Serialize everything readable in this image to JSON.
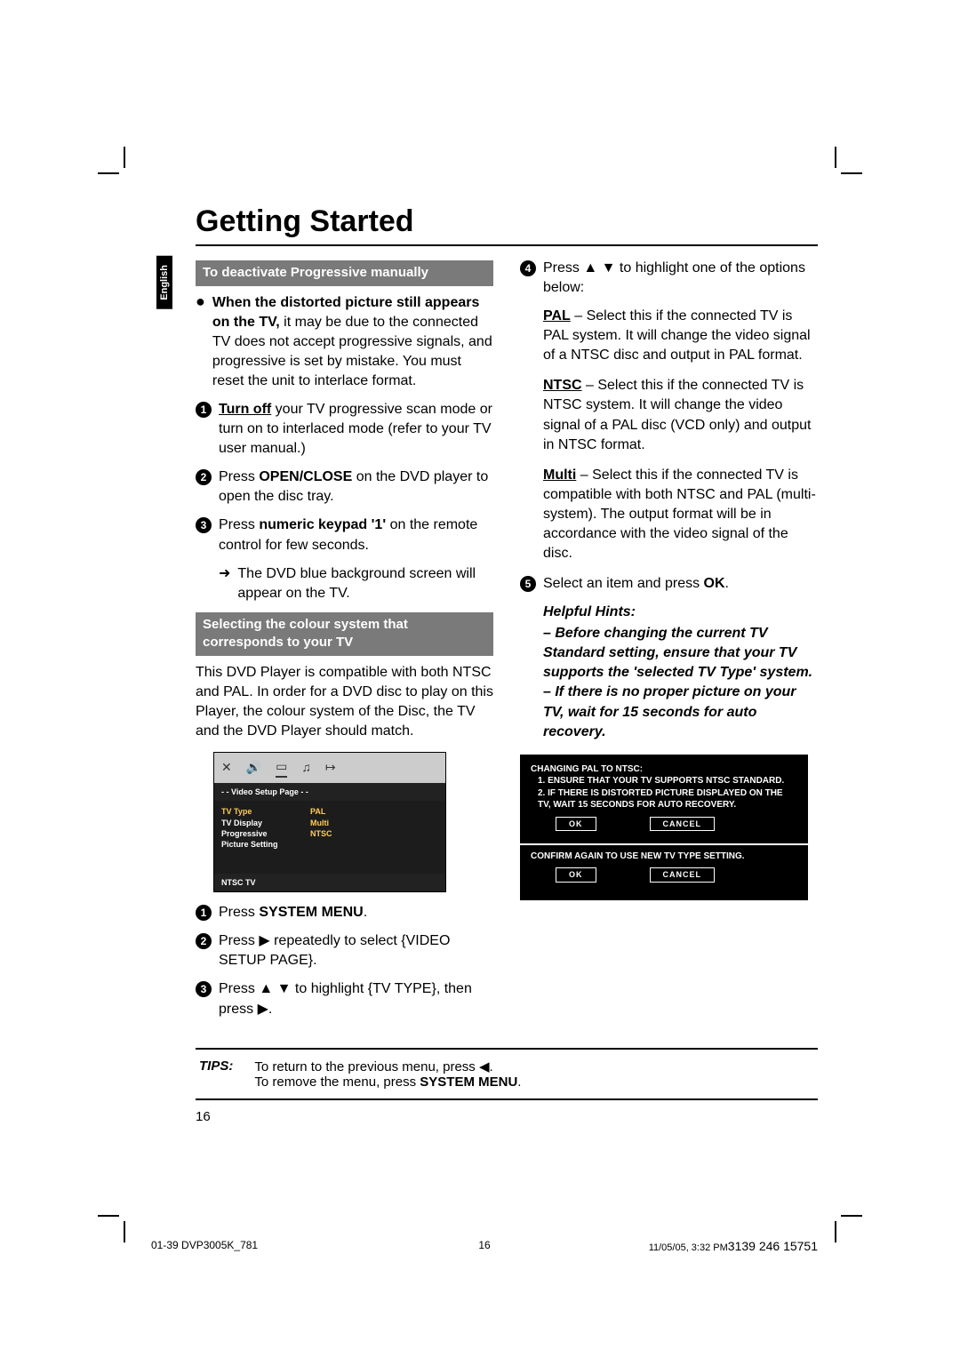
{
  "title": "Getting Started",
  "langTab": "English",
  "left": {
    "sectionA": "To deactivate Progressive manually",
    "a_lead_bold": "When the distorted picture still appears on the TV,",
    "a_lead_rest": " it may be due to the connected TV does not accept progressive signals, and progressive is set by mistake.  You must reset the unit to interlace format.",
    "step1_a": "Turn off",
    "step1_b": " your TV progressive scan mode or turn on to interlaced mode (refer to your TV user manual.)",
    "step2_a": "Press ",
    "step2_b": "OPEN/CLOSE",
    "step2_c": " on the DVD player to open the disc tray.",
    "step3_a": "Press ",
    "step3_b": "numeric keypad '1'",
    "step3_c": " on the remote control for few seconds.",
    "step3_arrow": "The DVD blue background screen will appear on the TV.",
    "sectionB": "Selecting the colour system that corresponds to your TV",
    "b_para": "This DVD Player is compatible with both NTSC and PAL. In order for a DVD disc to play on this Player, the colour system of the Disc, the TV and the DVD Player should match.",
    "osd": {
      "title": "- -   Video Setup Page   - -",
      "rows": [
        {
          "k": "TV Type",
          "v": "PAL"
        },
        {
          "k": "TV Display",
          "v": "Multi"
        },
        {
          "k": "Progressive",
          "v": "NTSC"
        },
        {
          "k": "Picture Setting",
          "v": ""
        }
      ],
      "footer": "NTSC TV"
    },
    "step1b_a": "Press ",
    "step1b_b": "SYSTEM MENU",
    "step2b": "Press ▶ repeatedly to select {VIDEO SETUP PAGE}.",
    "step3b": "Press ▲ ▼ to highlight {TV TYPE}, then press ▶."
  },
  "right": {
    "step4": "Press ▲ ▼ to highlight one of the options below:",
    "pal_b": "PAL",
    "pal_t": " – Select this if the connected TV is PAL system. It will change the video signal of a NTSC disc and output in PAL format.",
    "ntsc_b": "NTSC",
    "ntsc_t": " – Select this if the connected TV is NTSC system.  It will change the video signal of a PAL disc (VCD only) and output in NTSC format.",
    "multi_b": "Multi",
    "multi_t": " – Select this if the connected TV is compatible with both NTSC and PAL (multi-system).  The output format will be in accordance with the video signal of the disc.",
    "step5_a": "Select an item and press ",
    "step5_b": "OK",
    "hints_h": "Helpful Hints:",
    "hints_1": "–    Before changing the current TV Standard setting, ensure that your TV supports the 'selected TV Type' system.",
    "hints_2": "–    If there is no proper picture on your TV, wait for 15 seconds for auto recovery.",
    "dialog": {
      "h1": "CHANGING PAL TO NTSC:",
      "l1": "1. ENSURE THAT YOUR TV SUPPORTS NTSC STANDARD.",
      "l2": "2. IF THERE IS DISTORTED PICTURE DISPLAYED ON THE TV, WAIT 15 SECONDS FOR AUTO RECOVERY.",
      "ok": "OK",
      "cancel": "CANCEL",
      "h2": "CONFIRM AGAIN TO USE NEW TV TYPE SETTING."
    }
  },
  "tips": {
    "label": "TIPS:",
    "line1": "To return to the previous menu, press ◀.",
    "line2a": "To remove the menu, press ",
    "line2b": "SYSTEM MENU"
  },
  "pageNum": "16",
  "footer": {
    "left": "01-39 DVP3005K_781",
    "center": "16",
    "right_a": "11/05/05, 3:32 PM",
    "right_b": "3139 246 15751"
  }
}
